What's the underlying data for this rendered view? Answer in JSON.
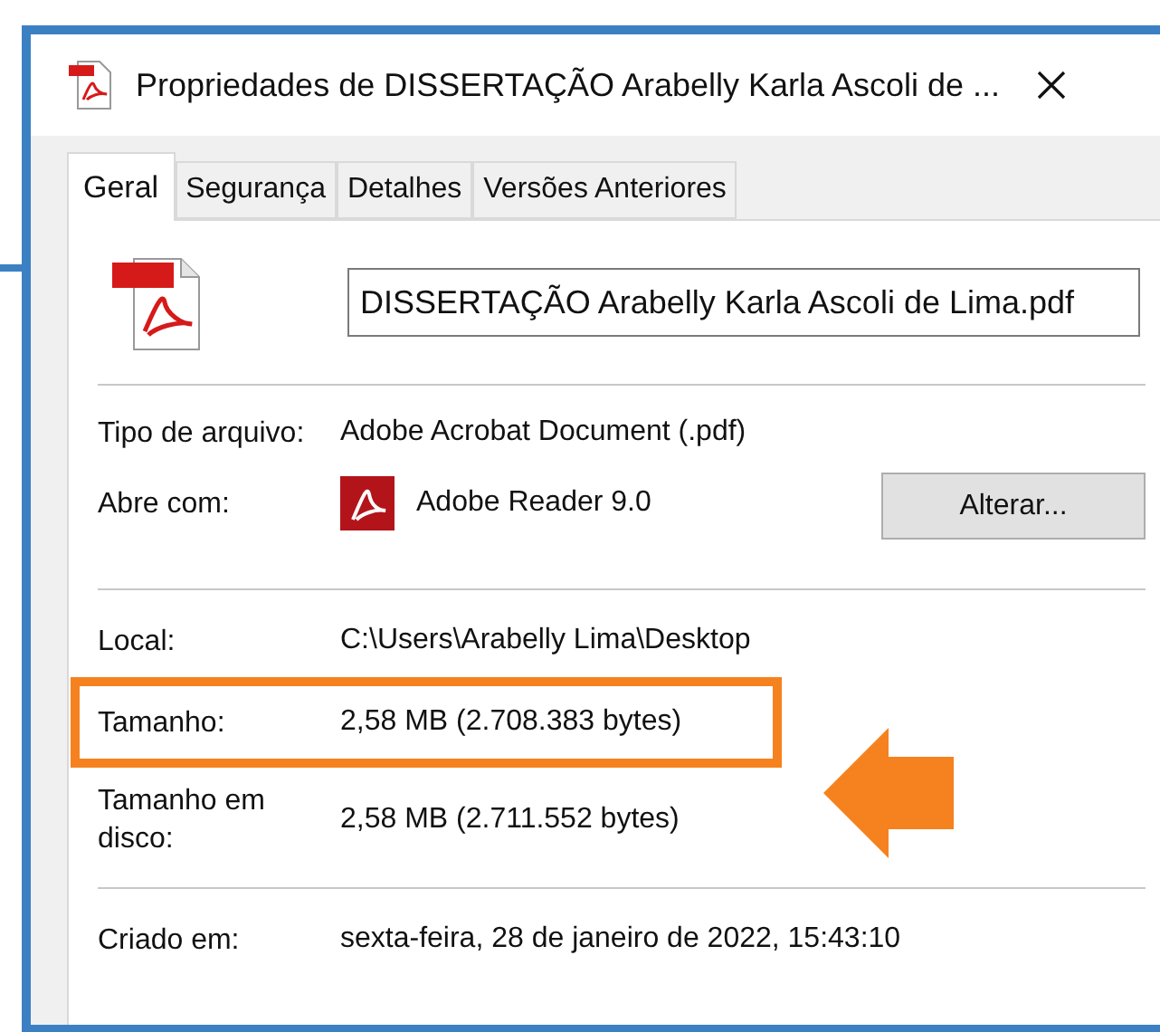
{
  "window": {
    "title": "Propriedades de DISSERTAÇÃO Arabelly Karla Ascoli de ..."
  },
  "tabs": [
    {
      "label": "Geral",
      "selected": true
    },
    {
      "label": "Segurança",
      "selected": false
    },
    {
      "label": "Detalhes",
      "selected": false
    },
    {
      "label": "Versões Anteriores",
      "selected": false
    }
  ],
  "file_name": "DISSERTAÇÃO Arabelly Karla Ascoli de Lima.pdf",
  "sections": [
    [
      {
        "label": "Tipo de arquivo:",
        "value": "Adobe Acrobat Document (.pdf)",
        "highlighted": false
      },
      {
        "label": "Abre com:",
        "value": "Adobe Reader 9.0",
        "app_icon": true,
        "button": "Alterar...",
        "highlighted": false
      }
    ],
    [
      {
        "label": "Local:",
        "value": "C:\\Users\\Arabelly Lima\\Desktop",
        "highlighted": false
      },
      {
        "label": "Tamanho:",
        "value": "2,58 MB (2.708.383 bytes)",
        "highlighted": true
      },
      {
        "label": "Tamanho em disco:",
        "value": "2,58 MB (2.711.552 bytes)",
        "highlighted": false
      }
    ],
    [
      {
        "label": "Criado em:",
        "value": "sexta-feira, 28 de janeiro de 2022, 15:43:10",
        "highlighted": false
      }
    ]
  ]
}
